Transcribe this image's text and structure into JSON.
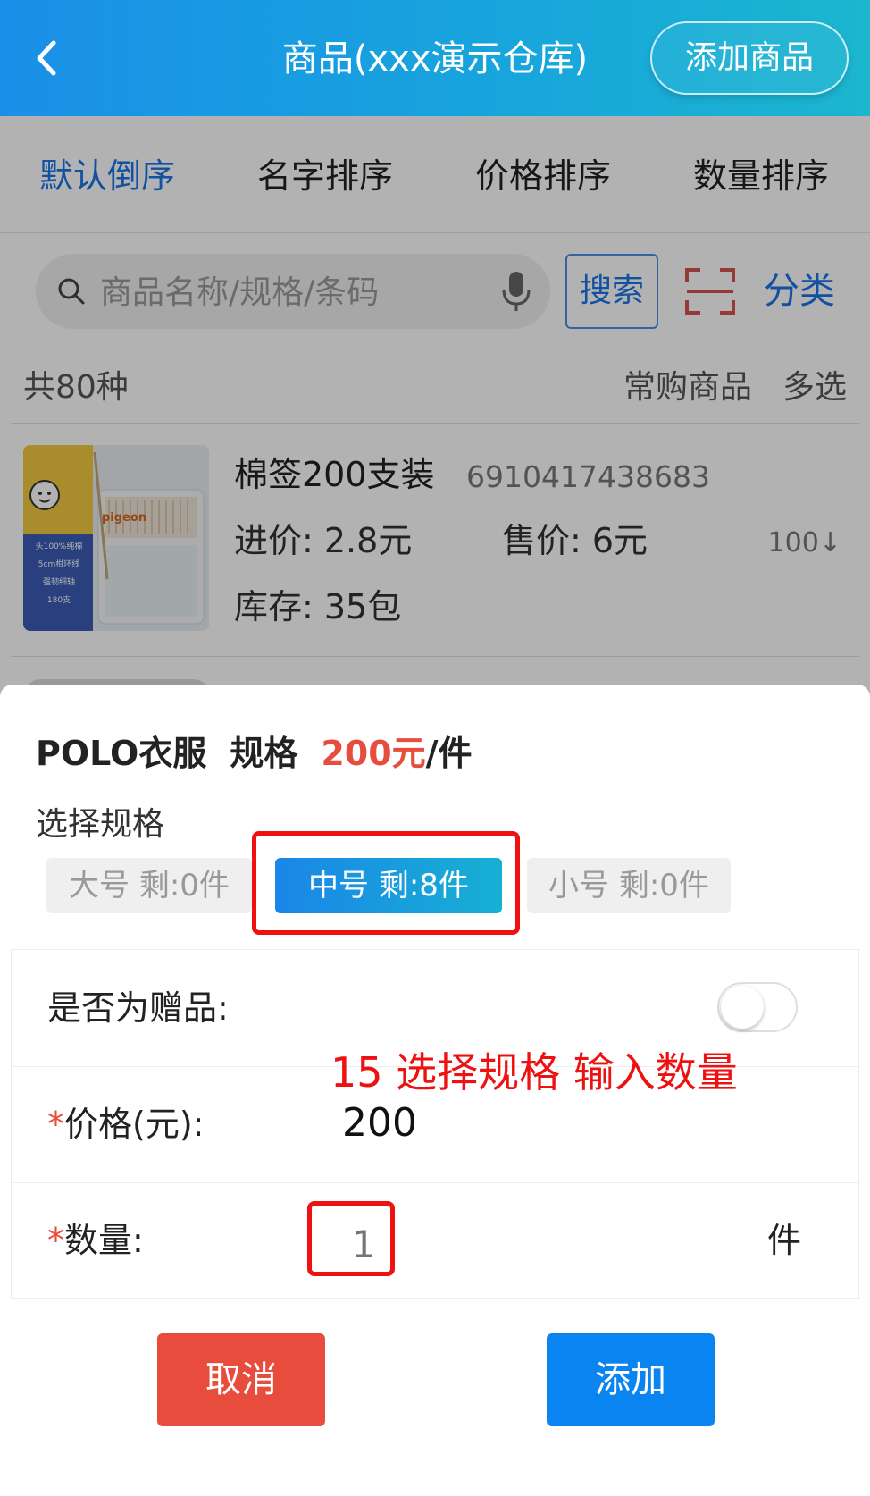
{
  "header": {
    "title": "商品(xxx演示仓库)",
    "add_button": "添加商品"
  },
  "sort_bar": {
    "items": [
      {
        "label": "默认倒序",
        "active": true
      },
      {
        "label": "名字排序",
        "active": false
      },
      {
        "label": "价格排序",
        "active": false
      },
      {
        "label": "数量排序",
        "active": false
      }
    ]
  },
  "search": {
    "placeholder": "商品名称/规格/条码",
    "button": "搜索",
    "category": "分类"
  },
  "summary": {
    "count": "共80种",
    "frequent": "常购商品",
    "multi_select": "多选"
  },
  "product": {
    "name": "棉签200支装",
    "barcode": "6910417438683",
    "cost": "进价: 2.8元",
    "sale": "售价: 6元",
    "rank": "100↓",
    "stock": "库存: 35包",
    "thumb_text": [
      "头100%纯棉",
      "5cm柑环线",
      "强韧细轴",
      "180支"
    ],
    "brand": "pigeon"
  },
  "sheet": {
    "name": "POLO衣服",
    "spec_word": "规格",
    "price": "200元",
    "unit_suffix": "/件",
    "select_spec_label": "选择规格",
    "specs": [
      {
        "label": "大号  剩:0件",
        "selected": false
      },
      {
        "label": "中号  剩:8件",
        "selected": true
      },
      {
        "label": "小号  剩:0件",
        "selected": false
      }
    ],
    "gift_label": "是否为赠品:",
    "gift_on": false,
    "price_label": "价格(元):",
    "price_value": "200",
    "qty_label": "数量:",
    "qty_value": "1",
    "qty_unit": "件",
    "cancel": "取消",
    "add": "添加",
    "required_mark": "*"
  },
  "annotation": "15 选择规格 输入数量",
  "colors": {
    "accent": "#1a73e8",
    "danger": "#e74c3c",
    "primary_button": "#0a84f0",
    "annotation": "#ee1111"
  }
}
